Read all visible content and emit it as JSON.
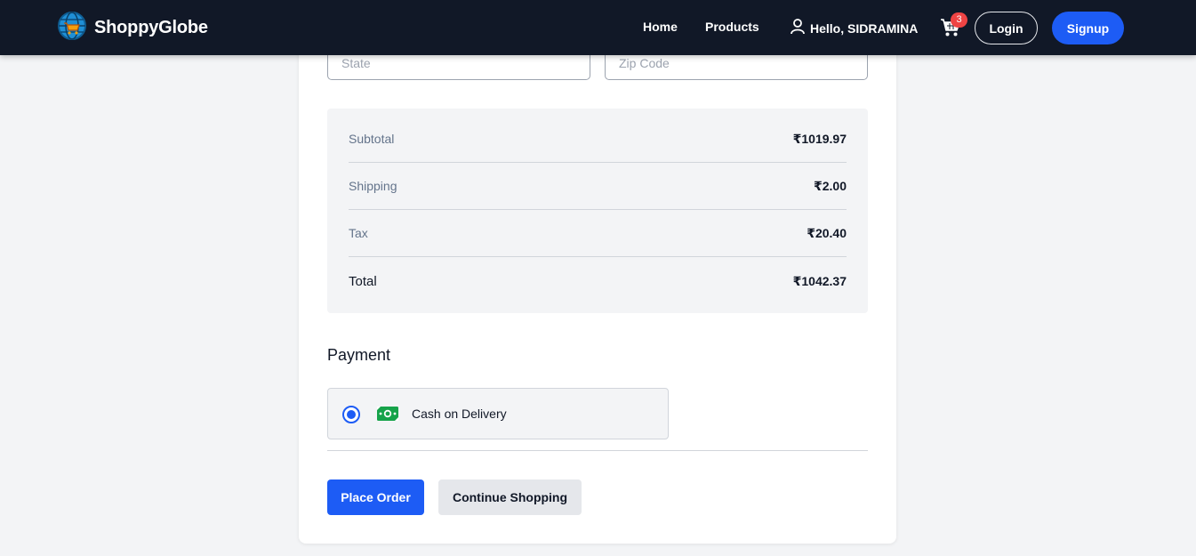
{
  "brand": {
    "name": "ShoppyGlobe",
    "icon": "globe-cart-icon"
  },
  "nav": {
    "links": [
      {
        "label": "Home"
      },
      {
        "label": "Products"
      }
    ],
    "greeting": "Hello, SIDRAMINA",
    "user_icon": "user-icon",
    "cart_icon": "shopping-cart-icon",
    "cart_count": "3",
    "login_label": "Login",
    "signup_label": "Signup"
  },
  "address": {
    "state_placeholder": "State",
    "zip_placeholder": "Zip Code"
  },
  "summary": {
    "subtotal": {
      "label": "Subtotal",
      "value": "₹1019.97"
    },
    "shipping": {
      "label": "Shipping",
      "value": "₹2.00"
    },
    "tax": {
      "label": "Tax",
      "value": "₹20.40"
    },
    "total": {
      "label": "Total",
      "value": "₹1042.37"
    }
  },
  "payment": {
    "title": "Payment",
    "option_label": "Cash on Delivery",
    "option_icon": "cash-icon",
    "selected": true
  },
  "actions": {
    "place_order_label": "Place Order",
    "continue_label": "Continue Shopping"
  },
  "colors": {
    "navbar": "#111827",
    "primary": "#1d5cf5",
    "badge": "#ef4444",
    "cash_icon": "#16a34a"
  }
}
